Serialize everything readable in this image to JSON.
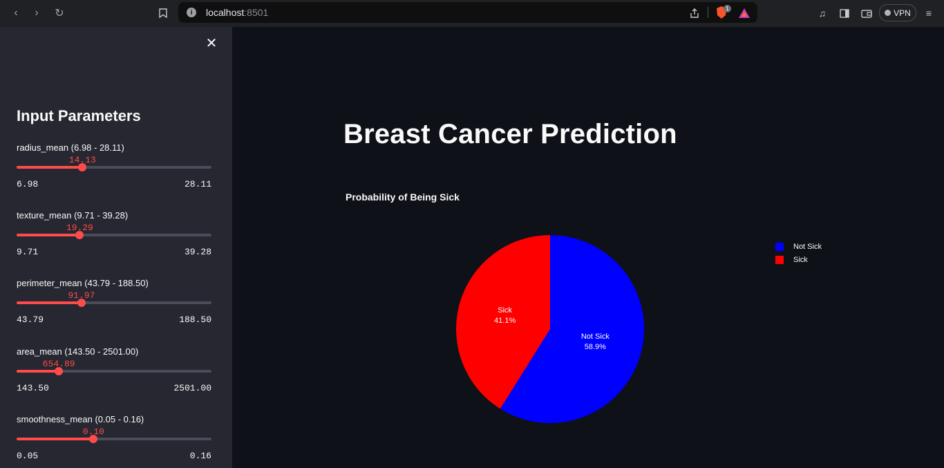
{
  "browser": {
    "url_host": "localhost",
    "url_port": ":8501",
    "brave_badge": "1",
    "vpn_label": "VPN"
  },
  "sidebar": {
    "title": "Input Parameters",
    "sliders": [
      {
        "label": "radius_mean (6.98 - 28.11)",
        "value": "14.13",
        "min": "6.98",
        "max": "28.11",
        "fraction": 0.338
      },
      {
        "label": "texture_mean (9.71 - 39.28)",
        "value": "19.29",
        "min": "9.71",
        "max": "39.28",
        "fraction": 0.324
      },
      {
        "label": "perimeter_mean (43.79 - 188.50)",
        "value": "91.97",
        "min": "43.79",
        "max": "188.50",
        "fraction": 0.333
      },
      {
        "label": "area_mean (143.50 - 2501.00)",
        "value": "654.89",
        "min": "143.50",
        "max": "2501.00",
        "fraction": 0.217
      },
      {
        "label": "smoothness_mean (0.05 - 0.16)",
        "value": "0.10",
        "min": "0.05",
        "max": "0.16",
        "fraction": 0.395
      }
    ]
  },
  "main": {
    "title": "Breast Cancer Prediction"
  },
  "chart_data": {
    "type": "pie",
    "title": "Probability of Being Sick",
    "categories": [
      "Not Sick",
      "Sick"
    ],
    "values": [
      58.9,
      41.1
    ],
    "value_labels": [
      "58.9%",
      "41.1%"
    ],
    "colors": [
      "#0000ff",
      "#ff0000"
    ],
    "legend_position": "right"
  }
}
